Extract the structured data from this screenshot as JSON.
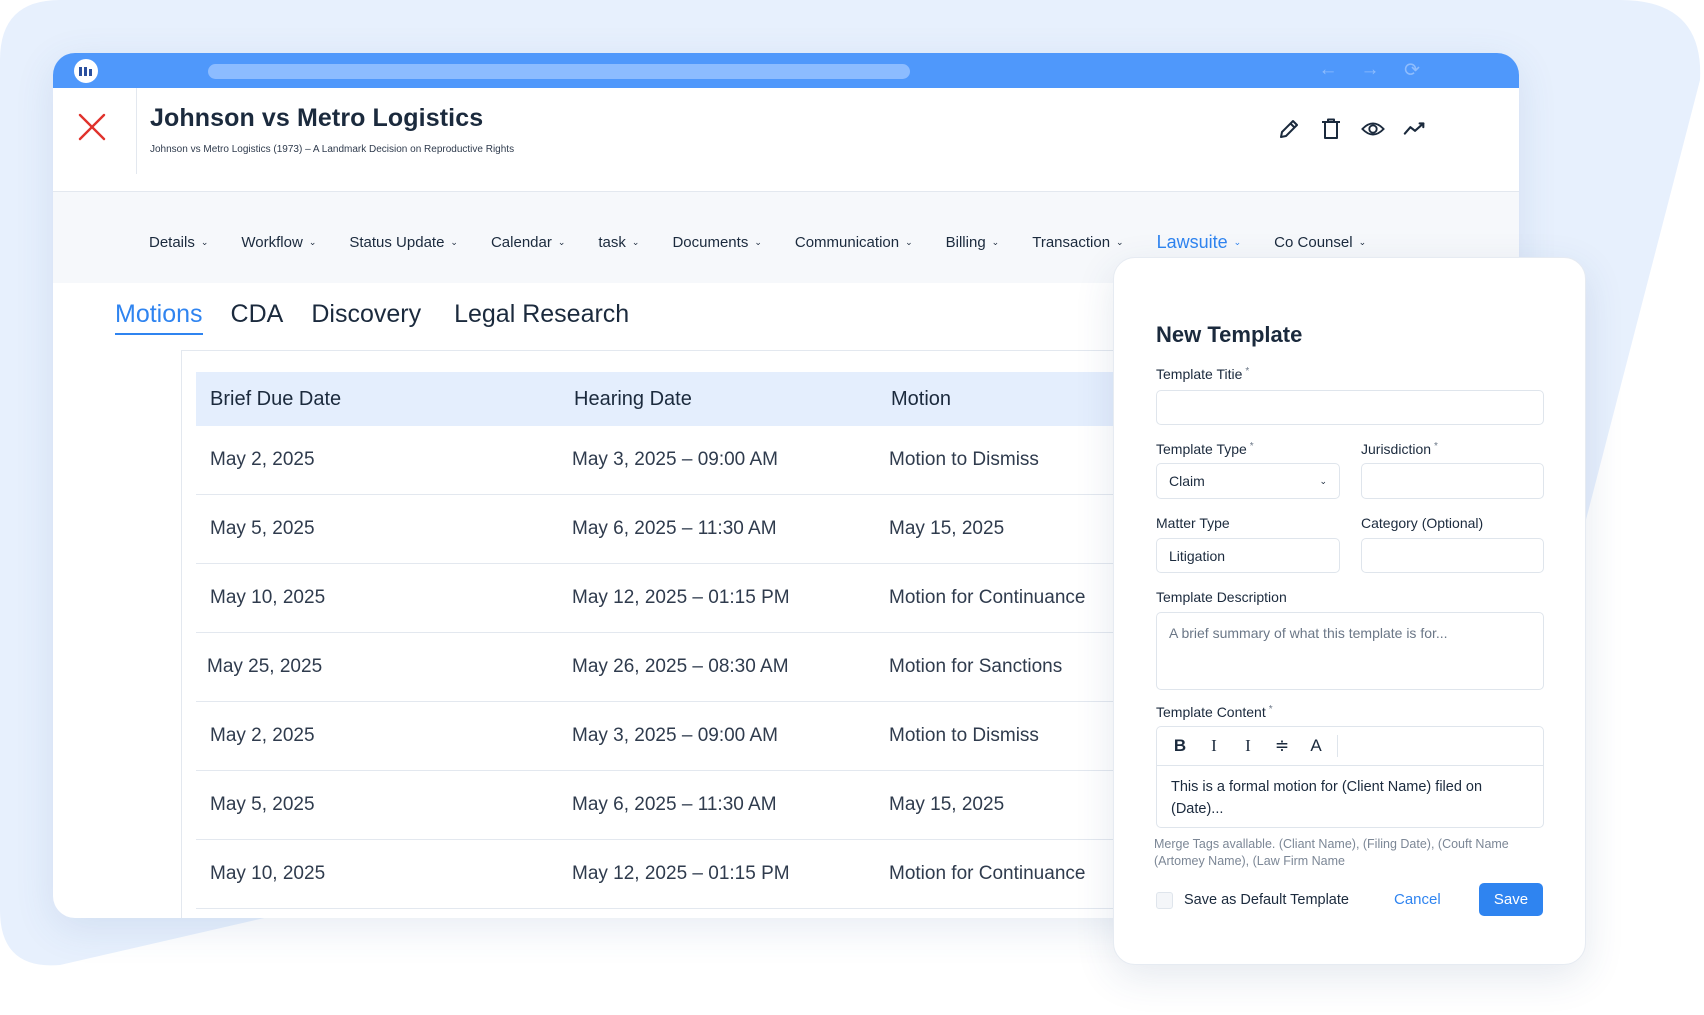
{
  "colors": {
    "accent": "#2f84f0",
    "chrome": "#4f98fb",
    "close": "#e0322c",
    "table_header": "#e4eefd",
    "background_shape": "#e7f0fd"
  },
  "chrome": {
    "logo": "app-logo",
    "nav": [
      "←",
      "→",
      "⟳"
    ]
  },
  "header": {
    "title": "Johnson vs Metro Logistics",
    "subtitle": "Johnson vs Metro Logistics (1973) – A Landmark Decision on Reproductive Rights",
    "actions": [
      "pencil-icon",
      "trash-icon",
      "eye-icon",
      "trend-icon"
    ]
  },
  "menu": {
    "items": [
      {
        "label": "Details"
      },
      {
        "label": "Workflow"
      },
      {
        "label": "Status Update"
      },
      {
        "label": "Calendar"
      },
      {
        "label": "task"
      },
      {
        "label": "Documents"
      },
      {
        "label": "Communication"
      },
      {
        "label": "Billing"
      },
      {
        "label": "Transaction"
      },
      {
        "label": "Lawsuite",
        "active": true
      },
      {
        "label": "Co Counsel"
      }
    ]
  },
  "subtabs": [
    {
      "label": "Motions",
      "active": true
    },
    {
      "label": "CDA"
    },
    {
      "label": "Discovery"
    },
    {
      "label": "Legal Research"
    }
  ],
  "table": {
    "columns": [
      "Brief Due Date",
      "Hearing Date",
      "Motion"
    ],
    "rows": [
      [
        "May 2, 2025",
        "May 3, 2025 – 09:00 AM",
        "Motion to Dismiss"
      ],
      [
        "May 5, 2025",
        "May 6, 2025 – 11:30 AM",
        "May 15, 2025"
      ],
      [
        "May 10, 2025",
        "May 12, 2025 – 01:15 PM",
        "Motion for Continuance"
      ],
      [
        "May 25, 2025",
        "May 26, 2025 – 08:30 AM",
        "Motion for Sanctions"
      ],
      [
        "May 2, 2025",
        "May 3, 2025 – 09:00 AM",
        "Motion to Dismiss"
      ],
      [
        "May 5, 2025",
        "May 6, 2025 – 11:30 AM",
        "May 15, 2025"
      ],
      [
        "May 10, 2025",
        "May 12, 2025 – 01:15 PM",
        "Motion for Continuance"
      ]
    ]
  },
  "modal": {
    "title": "New Template",
    "template_title_label": "Template Titie",
    "template_title_value": "",
    "template_type_label": "Template Type",
    "template_type_value": "Claim",
    "jurisdiction_label": "Jurisdiction",
    "jurisdiction_value": "",
    "matter_type_label": "Matter Type",
    "matter_type_value": "Litigation",
    "category_label": "Category (Optional)",
    "category_value": "",
    "description_label": "Template Description",
    "description_placeholder": "A brief summary of what this template is for...",
    "content_label": "Template Content",
    "toolbar": [
      "B",
      "I",
      "I",
      "≑",
      "A"
    ],
    "content_line1": "This is a formal motion for (Client Name) filed on",
    "content_line2": "(Date)...",
    "merge_tags_line1": "Merge Tags avallable. (Cliant Name), (Filing Date), (Couft Name",
    "merge_tags_line2": "(Artomey Name), (Law Firm Name",
    "default_checkbox_label": "Save as Default Template",
    "cancel_label": "Cancel",
    "save_label": "Save",
    "required_mark": "*"
  }
}
